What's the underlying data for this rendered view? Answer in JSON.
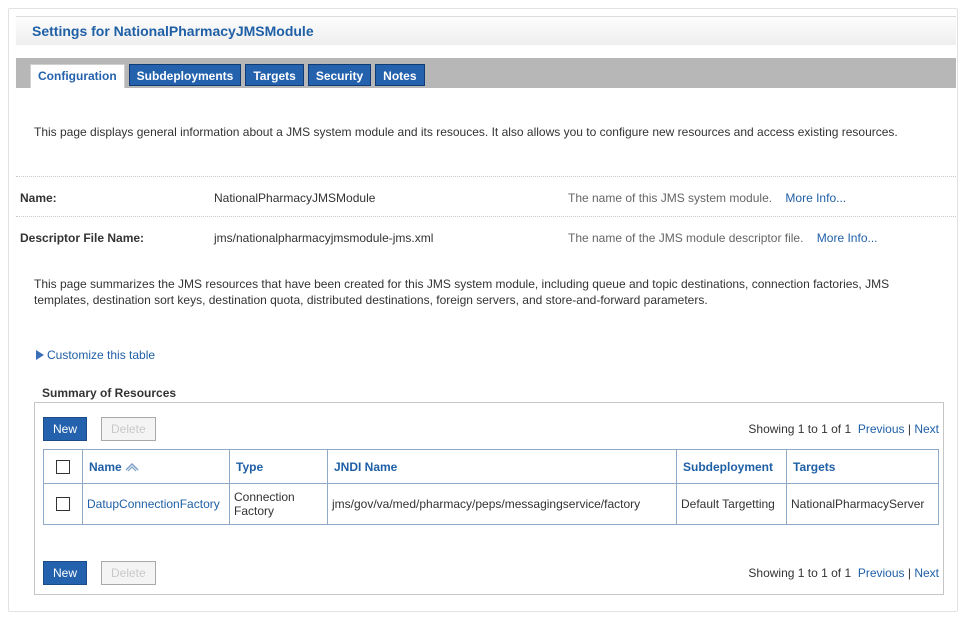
{
  "header": {
    "title": "Settings for NationalPharmacyJMSModule"
  },
  "tabs": [
    {
      "label": "Configuration"
    },
    {
      "label": "Subdeployments"
    },
    {
      "label": "Targets"
    },
    {
      "label": "Security"
    },
    {
      "label": "Notes"
    }
  ],
  "intro": "This page displays general information about a JMS system module and its resouces. It also allows you to configure new resources and access existing resources.",
  "info": {
    "name_label": "Name:",
    "name_value": "NationalPharmacyJMSModule",
    "name_help": "The name of this JMS system module.",
    "descriptor_label": "Descriptor File Name:",
    "descriptor_value": "jms/nationalpharmacyjmsmodule-jms.xml",
    "descriptor_help": "The name of the JMS module descriptor file.",
    "more_info": "More Info..."
  },
  "summary_text": "This page summarizes the JMS resources that have been created for this JMS system module, including queue and topic destinations, connection factories, JMS templates, destination sort keys, destination quota, distributed destinations, foreign servers, and store-and-forward parameters.",
  "customize": "Customize this table",
  "table_title": "Summary of Resources",
  "buttons": {
    "new": "New",
    "delete": "Delete"
  },
  "pager": {
    "showing": "Showing 1 to 1 of 1",
    "previous": "Previous",
    "sep": "|",
    "next": "Next"
  },
  "columns": {
    "name": "Name",
    "sort_icon": "sort-asc-icon",
    "type": "Type",
    "jndi": "JNDI Name",
    "subdeployment": "Subdeployment",
    "targets": "Targets"
  },
  "rows": [
    {
      "name": "DatupConnectionFactory",
      "type": "Connection Factory",
      "jndi": "jms/gov/va/med/pharmacy/peps/messagingservice/factory",
      "subdeployment": "Default Targetting",
      "targets": "NationalPharmacyServer"
    }
  ],
  "colors": {
    "accent": "#2462ad",
    "link": "#1f5fa6",
    "tab_strip": "#b7b7b7"
  }
}
